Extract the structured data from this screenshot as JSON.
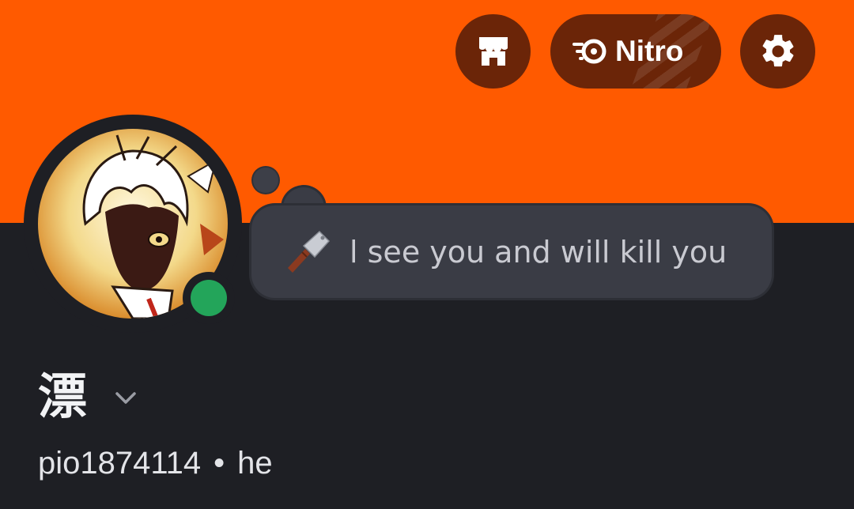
{
  "header": {
    "banner_color": "#ff5a00",
    "shop_button": {
      "icon": "shop-icon"
    },
    "nitro_button": {
      "icon": "nitro-icon",
      "label": "Nitro"
    },
    "settings_button": {
      "icon": "gear-icon"
    }
  },
  "profile": {
    "avatar": {
      "status": "online",
      "status_color": "#23a55a"
    },
    "custom_status": {
      "emoji": "knife-icon",
      "text": "l see you and will kill you"
    },
    "display_name": "漂",
    "username": "pio1874114",
    "separator": "•",
    "pronouns": "he"
  }
}
